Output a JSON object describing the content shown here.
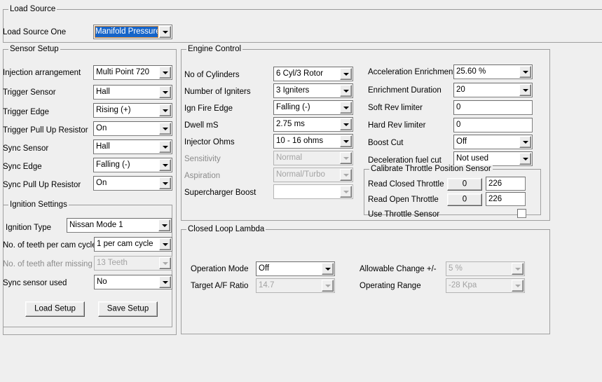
{
  "colors": {
    "window_bg": "#efefef",
    "selection_blue": "#1664c8",
    "field_white": "#ffffff",
    "border_grey": "#a0a0a0",
    "disabled_text": "#a3a3a3"
  },
  "load_source": {
    "group_title": "Load Source",
    "fields": [
      {
        "label": "Load Source One",
        "value": "Manifold Pressure",
        "state": "selected"
      }
    ]
  },
  "sensor_setup": {
    "group_title": "Sensor Setup",
    "fields": [
      {
        "label": "Injection arrangement",
        "value": "Multi Point 720",
        "state": "enabled"
      },
      {
        "label": "Trigger Sensor",
        "value": "Hall",
        "state": "enabled"
      },
      {
        "label": "Trigger Edge",
        "value": "Rising (+)",
        "state": "enabled"
      },
      {
        "label": "Trigger Pull Up Resistor",
        "value": "On",
        "state": "enabled"
      },
      {
        "label": "Sync Sensor",
        "value": "Hall",
        "state": "enabled"
      },
      {
        "label": "Sync Edge",
        "value": "Falling (-)",
        "state": "enabled"
      },
      {
        "label": "Sync Pull Up Resistor",
        "value": "On",
        "state": "enabled"
      }
    ]
  },
  "ignition_settings": {
    "group_title": "Ignition Settings",
    "fields": [
      {
        "label": "Ignition Type",
        "value": "Nissan Mode 1",
        "state": "enabled"
      },
      {
        "label": "No. of teeth per cam cycle",
        "value": "1 per cam cycle",
        "state": "enabled"
      },
      {
        "label": "No. of teeth after missing",
        "value": "13 Teeth",
        "state": "disabled"
      },
      {
        "label": "Sync sensor used",
        "value": "No",
        "state": "enabled"
      }
    ],
    "buttons": [
      {
        "label": "Load Setup"
      },
      {
        "label": "Save Setup"
      }
    ]
  },
  "engine_control": {
    "group_title": "Engine Control",
    "left_fields": [
      {
        "label": "No of Cylinders",
        "value": "6 Cyl/3 Rotor",
        "state": "enabled"
      },
      {
        "label": "Number of Igniters",
        "value": "3 Igniters",
        "state": "enabled"
      },
      {
        "label": "Ign Fire Edge",
        "value": "Falling (-)",
        "state": "enabled"
      },
      {
        "label": "Dwell mS",
        "value": "2.75 ms",
        "state": "enabled"
      },
      {
        "label": "Injector Ohms",
        "value": "10 - 16 ohms",
        "state": "enabled"
      },
      {
        "label": "Sensitivity",
        "value": "Normal",
        "state": "disabled"
      },
      {
        "label": "Aspiration",
        "value": "Normal/Turbo",
        "state": "disabled"
      },
      {
        "label": "Supercharger Boost",
        "value": "",
        "state": "disabled"
      }
    ],
    "right_fields": [
      {
        "label": "Acceleration Enrichment",
        "value": "25.60 %",
        "state": "enabled",
        "kind": "combo"
      },
      {
        "label": "Enrichment Duration",
        "value": "20",
        "state": "enabled",
        "kind": "combo"
      },
      {
        "label": "Soft Rev limiter",
        "value": "0",
        "state": "enabled",
        "kind": "text"
      },
      {
        "label": "Hard Rev limiter",
        "value": "0",
        "state": "enabled",
        "kind": "text"
      },
      {
        "label": "Boost Cut",
        "value": "Off",
        "state": "enabled",
        "kind": "combo"
      },
      {
        "label": "Deceleration fuel cut",
        "value": "Not used",
        "state": "enabled",
        "kind": "combo"
      }
    ],
    "throttle_calibration": {
      "group_title": "Calibrate Throttle Position Sensor",
      "rows": [
        {
          "label": "Read Closed Throttle",
          "button_label": "0",
          "value": "226"
        },
        {
          "label": "Read Open Throttle",
          "button_label": "0",
          "value": "226"
        }
      ],
      "checkbox": {
        "label": "Use Throttle Sensor",
        "checked": false
      }
    }
  },
  "closed_loop_lambda": {
    "group_title": "Closed Loop Lambda",
    "left_fields": [
      {
        "label": "Operation Mode",
        "value": "Off",
        "state": "enabled"
      },
      {
        "label": "Target A/F Ratio",
        "value": "14.7",
        "state": "disabled"
      }
    ],
    "right_fields": [
      {
        "label": "Allowable Change +/-",
        "value": "5 %",
        "state": "disabled"
      },
      {
        "label": "Operating Range",
        "value": "-28 Kpa",
        "state": "disabled"
      }
    ]
  }
}
